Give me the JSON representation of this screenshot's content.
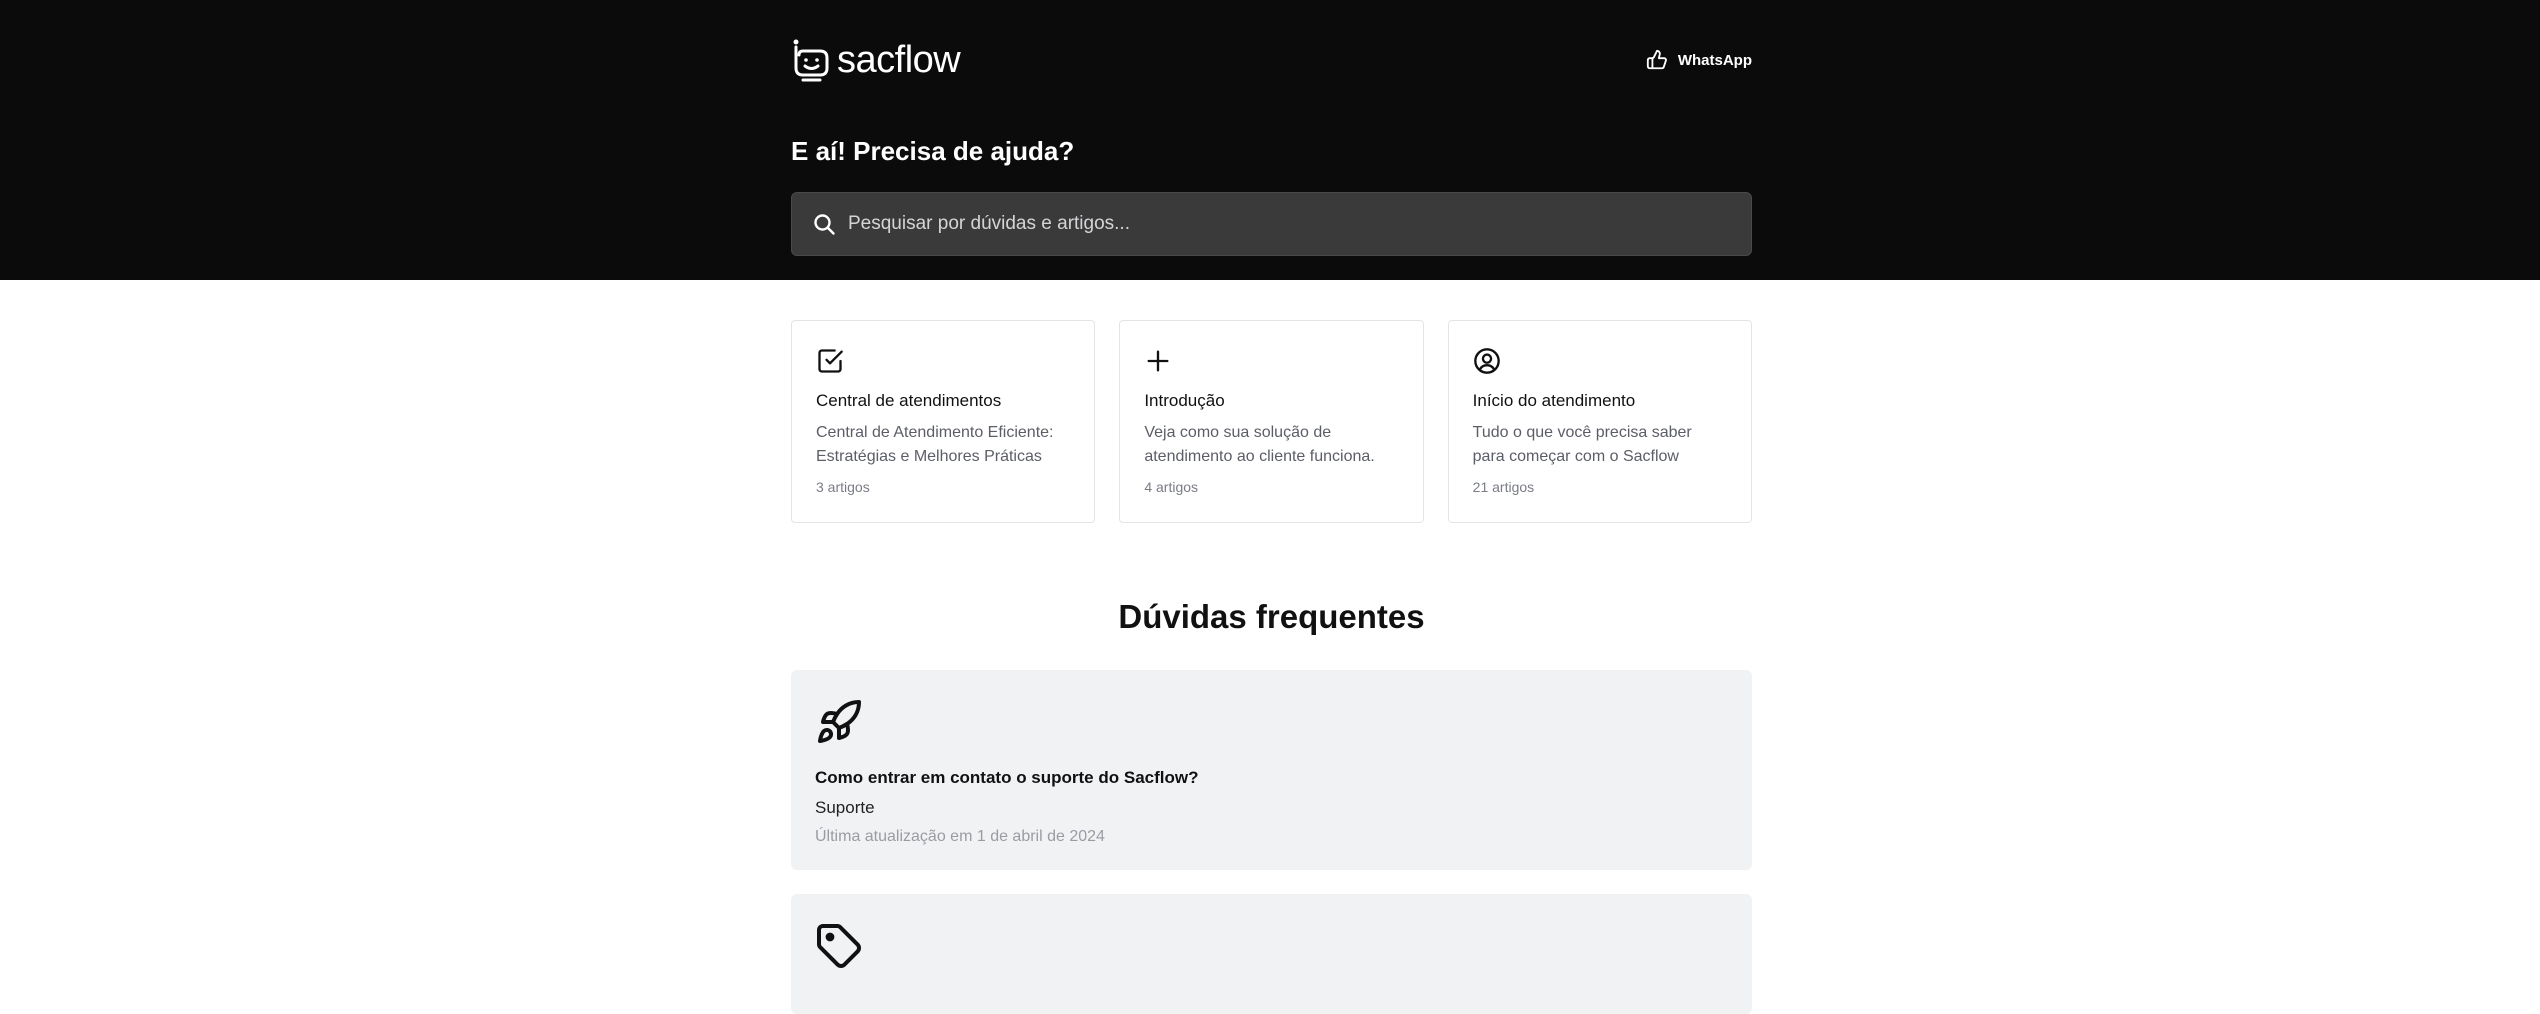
{
  "brand": {
    "name": "sacflow",
    "icon": "smiling-monitor-logo"
  },
  "header": {
    "whatsapp_label": "WhatsApp",
    "whatsapp_icon": "thumbs-up-icon"
  },
  "hero": {
    "title": "E aí! Precisa de ajuda?",
    "search_placeholder": "Pesquisar por dúvidas e artigos..."
  },
  "categories": [
    {
      "icon": "checkbox-icon",
      "title": "Central de atendimentos",
      "description": "Central de Atendimento Eficiente: Estratégias e Melhores Práticas",
      "count": "3 artigos"
    },
    {
      "icon": "plus-icon",
      "title": "Introdução",
      "description": "Veja como sua solução de atendimento ao cliente funciona.",
      "count": "4 artigos"
    },
    {
      "icon": "user-circle-icon",
      "title": "Início do atendimento",
      "description": "Tudo o que você precisa saber para começar com o Sacflow",
      "count": "21 artigos"
    }
  ],
  "faq": {
    "title": "Dúvidas frequentes",
    "items": [
      {
        "icon": "rocket-icon",
        "question": "Como entrar em contato o suporte do Sacflow?",
        "category": "Suporte",
        "updated": "Última atualização em 1 de abril de 2024"
      },
      {
        "icon": "tag-icon"
      }
    ]
  },
  "colors": {
    "hero_bg": "#0b0b0c",
    "search_bg": "#3a3a3b",
    "faq_card_bg": "#f1f2f4",
    "muted_text": "#5b5e66"
  }
}
